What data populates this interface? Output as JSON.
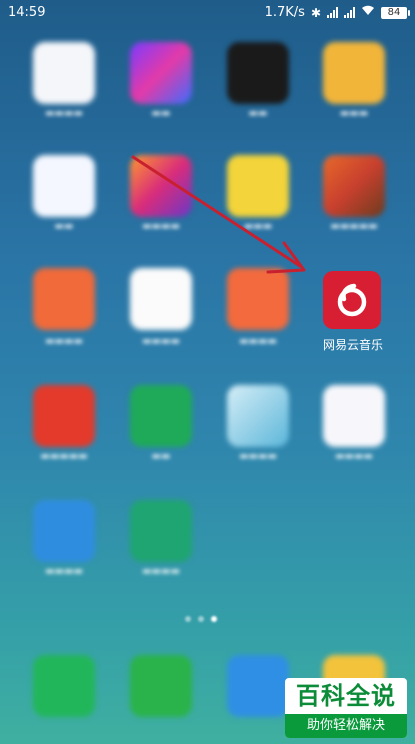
{
  "status_bar": {
    "time": "14:59",
    "network_speed": "1.7K/s",
    "battery": "84"
  },
  "home": {
    "focused_app": {
      "label": "网易云音乐",
      "color": "#d81e33",
      "icon": "netease-music-icon"
    }
  },
  "page_indicator": {
    "pages": 3,
    "active_index": 2
  },
  "watermark": {
    "title": "百科全说",
    "subtitle": "助你轻松解决"
  }
}
